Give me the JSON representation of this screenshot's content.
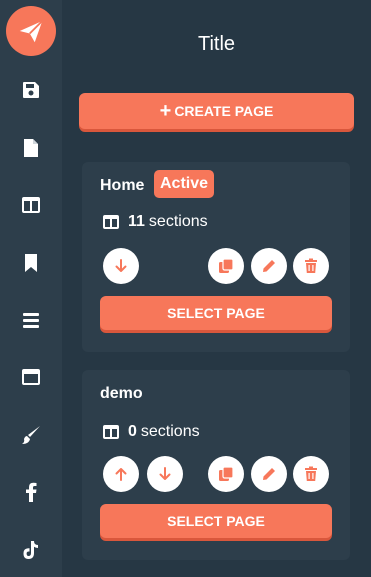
{
  "sidebar": {
    "logo_icon": "paper-plane-icon",
    "items": [
      {
        "icon": "save-icon"
      },
      {
        "icon": "file-icon"
      },
      {
        "icon": "columns-icon"
      },
      {
        "icon": "bookmark-icon"
      },
      {
        "icon": "list-icon"
      },
      {
        "icon": "window-icon"
      },
      {
        "icon": "brush-icon"
      },
      {
        "icon": "facebook-icon"
      },
      {
        "icon": "tiktok-icon"
      }
    ]
  },
  "main": {
    "title": "Title",
    "create_plus": "+",
    "create_label": "CREATE PAGE"
  },
  "pages": [
    {
      "name": "Home",
      "badge": "Active",
      "section_count": "11",
      "sections_label": "sections",
      "select_label": "SELECT PAGE"
    },
    {
      "name": "demo",
      "section_count": "0",
      "sections_label": "sections",
      "select_label": "SELECT PAGE"
    }
  ],
  "colors": {
    "accent": "#f7775a",
    "background": "#263744",
    "panel": "#2d3e4b",
    "text": "#ffffff"
  }
}
